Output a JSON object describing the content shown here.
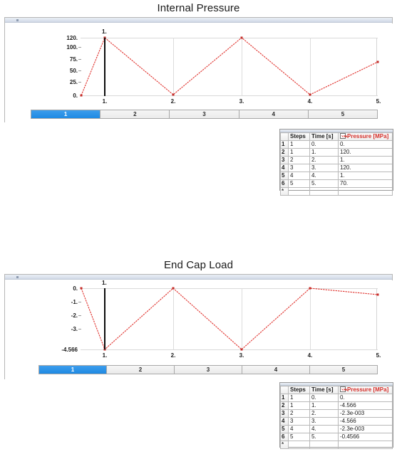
{
  "charts": [
    {
      "title": "Internal Pressure",
      "marker_label": "1.",
      "step_bar": {
        "steps": [
          "1",
          "2",
          "3",
          "4",
          "5"
        ],
        "active_index": 0
      },
      "grid": {
        "columns": [
          "",
          "Steps",
          "Time [s]",
          "Pressure [MPa]"
        ],
        "series_column_checked": true,
        "series_column_color": "#d4302b",
        "rows": [
          {
            "num": "1",
            "steps": "1",
            "time": "0.",
            "value": "0."
          },
          {
            "num": "2",
            "steps": "1",
            "time": "1.",
            "value": "120."
          },
          {
            "num": "3",
            "steps": "2",
            "time": "2.",
            "value": "1."
          },
          {
            "num": "4",
            "steps": "3",
            "time": "3.",
            "value": "120."
          },
          {
            "num": "5",
            "steps": "4",
            "time": "4.",
            "value": "1."
          },
          {
            "num": "6",
            "steps": "5",
            "time": "5.",
            "value": "70."
          },
          {
            "num": "*",
            "steps": "",
            "time": "",
            "value": ""
          }
        ]
      }
    },
    {
      "title": "End Cap Load",
      "marker_label": "1.",
      "step_bar": {
        "steps": [
          "1",
          "2",
          "3",
          "4",
          "5"
        ],
        "active_index": 0
      },
      "grid": {
        "columns": [
          "",
          "Steps",
          "Time [s]",
          "Pressure [MPa]"
        ],
        "series_column_checked": true,
        "series_column_color": "#d4302b",
        "rows": [
          {
            "num": "1",
            "steps": "1",
            "time": "0.",
            "value": "0."
          },
          {
            "num": "2",
            "steps": "1",
            "time": "1.",
            "value": "-4.566"
          },
          {
            "num": "3",
            "steps": "2",
            "time": "2.",
            "value": "-2.3e-003"
          },
          {
            "num": "4",
            "steps": "3",
            "time": "3.",
            "value": "-4.566"
          },
          {
            "num": "5",
            "steps": "4",
            "time": "4.",
            "value": "-2.3e-003"
          },
          {
            "num": "6",
            "steps": "5",
            "time": "5.",
            "value": "-0.4566"
          },
          {
            "num": "*",
            "steps": "",
            "time": "",
            "value": ""
          }
        ]
      }
    }
  ],
  "chart_data": [
    {
      "type": "line",
      "title": "Internal Pressure",
      "xlabel": "Time [s]",
      "ylabel": "Pressure [MPa]",
      "series": [
        {
          "name": "Pressure [MPa]",
          "color": "#e0332e",
          "x": [
            0,
            1,
            2,
            3,
            4,
            5
          ],
          "values": [
            0,
            120,
            1,
            120,
            1,
            70
          ]
        }
      ],
      "x": [
        0,
        1,
        2,
        3,
        4,
        5
      ],
      "xticks": [
        "1.",
        "2.",
        "3.",
        "4.",
        "5."
      ],
      "xtick_values": [
        1,
        2,
        3,
        4,
        5
      ],
      "yticks": [
        "0.",
        "25.",
        "50.",
        "75.",
        "100.",
        "120."
      ],
      "ytick_values": [
        0,
        25,
        50,
        75,
        100,
        120
      ],
      "xlim": [
        0,
        5
      ],
      "ylim": [
        0,
        120
      ],
      "grid": true,
      "legend": "none",
      "markers": {
        "time_marker": 1,
        "time_marker_label": "1."
      },
      "steps": [
        "1",
        "2",
        "3",
        "4",
        "5"
      ]
    },
    {
      "type": "line",
      "title": "End Cap Load",
      "xlabel": "Time [s]",
      "ylabel": "Pressure [MPa]",
      "series": [
        {
          "name": "Pressure [MPa]",
          "color": "#e0332e",
          "x": [
            0,
            1,
            2,
            3,
            4,
            5
          ],
          "values": [
            0,
            -4.566,
            -0.0023,
            -4.566,
            -0.0023,
            -0.4566
          ]
        }
      ],
      "x": [
        0,
        1,
        2,
        3,
        4,
        5
      ],
      "xticks": [
        "1.",
        "2.",
        "3.",
        "4.",
        "5."
      ],
      "xtick_values": [
        1,
        2,
        3,
        4,
        5
      ],
      "yticks": [
        "-4.566",
        "-3.",
        "-2.",
        "-1.",
        "0."
      ],
      "ytick_values": [
        -4.566,
        -3,
        -2,
        -1,
        0
      ],
      "xlim": [
        0,
        5
      ],
      "ylim": [
        -4.566,
        0
      ],
      "grid": true,
      "legend": "none",
      "markers": {
        "time_marker": 1,
        "time_marker_label": "1."
      },
      "steps": [
        "1",
        "2",
        "3",
        "4",
        "5"
      ]
    }
  ]
}
